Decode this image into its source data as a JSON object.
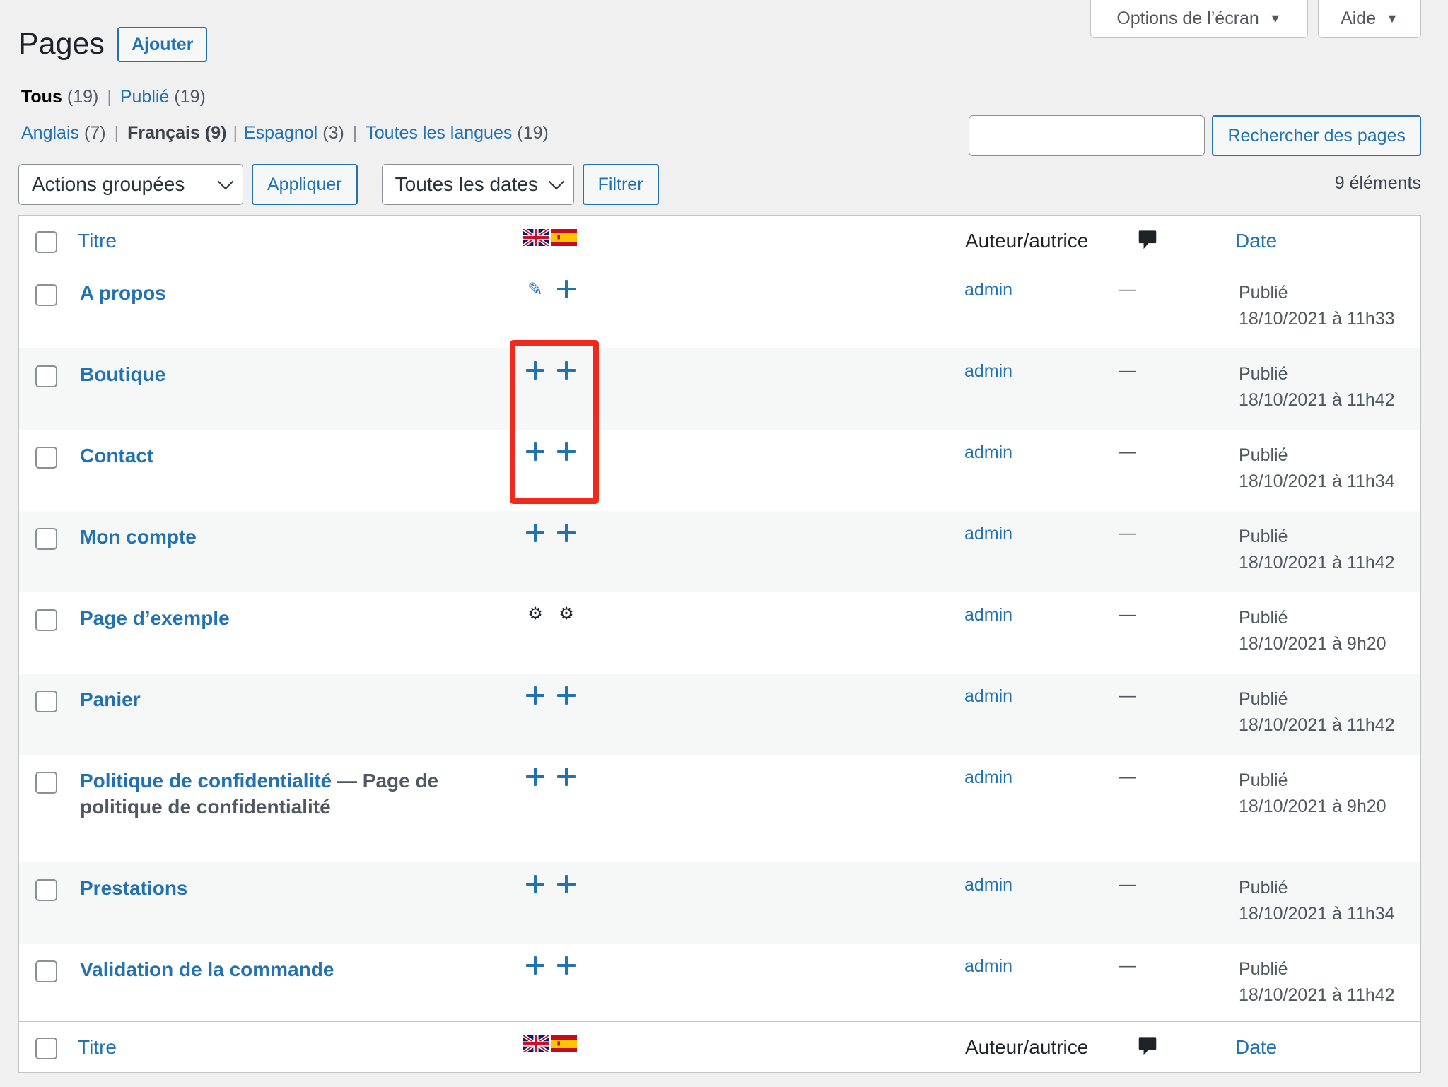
{
  "screen_options": {
    "options_label": "Options de l’écran",
    "help_label": "Aide"
  },
  "header": {
    "title": "Pages",
    "add_label": "Ajouter"
  },
  "status_filters": [
    {
      "label": "Tous",
      "count": "(19)"
    },
    {
      "label": "Publié",
      "count": "(19)"
    }
  ],
  "language_filters": [
    {
      "label": "Anglais",
      "count": "(7)"
    },
    {
      "label": "Français",
      "count": "(9)"
    },
    {
      "label": "Espagnol",
      "count": "(3)"
    },
    {
      "label": "Toutes les langues",
      "count": "(19)"
    }
  ],
  "search": {
    "button_label": "Rechercher des pages",
    "value": ""
  },
  "tablenav": {
    "bulk_actions": "Actions groupées",
    "apply_label": "Appliquer",
    "dates": "Toutes les dates",
    "filter_label": "Filtrer",
    "item_count": "9 éléments"
  },
  "columns": {
    "title": "Titre",
    "author": "Auteur/autrice",
    "date": "Date",
    "flags": [
      "uk-flag-icon",
      "es-flag-icon"
    ],
    "comment_icon": "comment-icon"
  },
  "rows": [
    {
      "title": "A propos",
      "suffix": "",
      "langs": [
        "edit",
        "add"
      ],
      "author": "admin",
      "comments": "—",
      "status": "Publié",
      "date": "18/10/2021 à 11h33"
    },
    {
      "title": "Boutique",
      "suffix": "",
      "langs": [
        "add",
        "add"
      ],
      "author": "admin",
      "comments": "—",
      "status": "Publié",
      "date": "18/10/2021 à 11h42"
    },
    {
      "title": "Contact",
      "suffix": "",
      "langs": [
        "add",
        "add"
      ],
      "author": "admin",
      "comments": "—",
      "status": "Publié",
      "date": "18/10/2021 à 11h34"
    },
    {
      "title": "Mon compte",
      "suffix": "",
      "langs": [
        "add",
        "add"
      ],
      "author": "admin",
      "comments": "—",
      "status": "Publié",
      "date": "18/10/2021 à 11h42"
    },
    {
      "title": "Page d’exemple",
      "suffix": "",
      "langs": [
        "gears",
        "gears"
      ],
      "author": "admin",
      "comments": "—",
      "status": "Publié",
      "date": "18/10/2021 à 9h20"
    },
    {
      "title": "Panier",
      "suffix": "",
      "langs": [
        "add",
        "add"
      ],
      "author": "admin",
      "comments": "—",
      "status": "Publié",
      "date": "18/10/2021 à 11h42"
    },
    {
      "title": "Politique de confidentialité",
      "suffix": " — Page de politique de confidentialité",
      "langs": [
        "add",
        "add"
      ],
      "author": "admin",
      "comments": "—",
      "status": "Publié",
      "date": "18/10/2021 à 9h20"
    },
    {
      "title": "Prestations",
      "suffix": "",
      "langs": [
        "add",
        "add"
      ],
      "author": "admin",
      "comments": "—",
      "status": "Publié",
      "date": "18/10/2021 à 11h34"
    },
    {
      "title": "Validation de la commande",
      "suffix": "",
      "langs": [
        "add",
        "add"
      ],
      "author": "admin",
      "comments": "—",
      "status": "Publié",
      "date": "18/10/2021 à 11h42"
    }
  ],
  "annotation": {
    "color": "#ef2a1c"
  }
}
